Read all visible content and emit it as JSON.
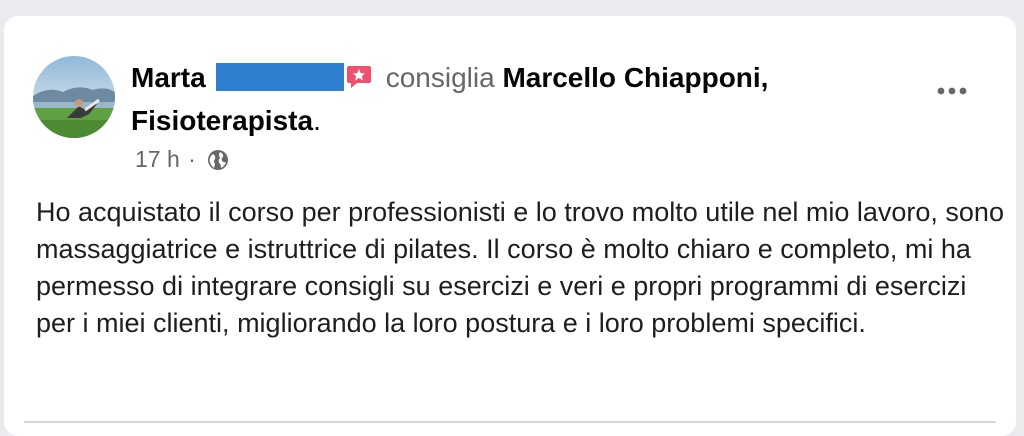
{
  "post": {
    "author_name": "Marta",
    "verb": "consiglia",
    "target_name": "Marcello Chiapponi, Fisioterapista",
    "target_punct": ".",
    "time": "17 h",
    "meta_sep": "·",
    "body": "Ho acquistato il corso per professionisti e lo trovo molto utile nel mio lavoro, sono massaggiatrice e istruttrice di pilates. Il corso è molto chiaro e completo, mi ha permesso di integrare consigli su esercizi e veri e propri programmi di esercizi per i miei clienti, migliorando la loro postura e i loro problemi specifici."
  },
  "icons": {
    "recommend": "recommend-star-icon",
    "privacy": "globe-icon",
    "more": "more-options-icon"
  },
  "colors": {
    "redaction": "#2f80d1",
    "recommend_badge": "#f0506e",
    "secondary_text": "#65676b"
  }
}
